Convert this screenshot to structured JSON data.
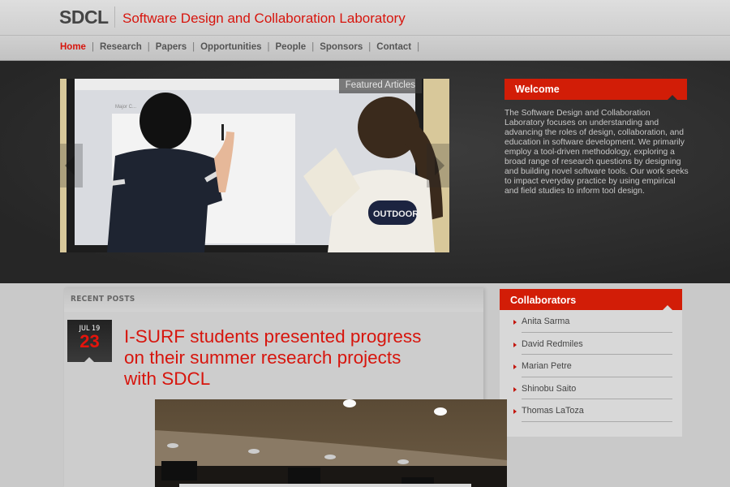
{
  "header": {
    "logo": "SDCL",
    "title": "Software Design and Collaboration Laboratory"
  },
  "nav": {
    "items": [
      {
        "label": "Home",
        "active": true
      },
      {
        "label": "Research"
      },
      {
        "label": "Papers"
      },
      {
        "label": "Opportunities"
      },
      {
        "label": "People"
      },
      {
        "label": "Sponsors"
      },
      {
        "label": "Contact"
      }
    ],
    "separator": "|"
  },
  "slider": {
    "label": "Featured Articles",
    "image_alt": "Students writing on a large interactive whiteboard"
  },
  "welcome": {
    "title": "Welcome",
    "text": "The Software Design and Collaboration Laboratory focuses on understanding and advancing the roles of design, collaboration, and education in software development. We primarily employ a tool-driven methodology, exploring a broad range of research questions by designing and building novel software tools. Our work seeks to impact everyday practice by using empirical and field studies to inform tool design."
  },
  "recent_posts": {
    "heading": "RECENT POSTS",
    "posts": [
      {
        "month_year": "JUL 19",
        "day": "23",
        "title": "I-SURF students presented progress on their summer research projects with SDCL",
        "image_alt": "Presentation room ceiling and screen"
      }
    ]
  },
  "collaborators": {
    "title": "Collaborators",
    "items": [
      "Anita Sarma",
      "David Redmiles",
      "Marian Petre",
      "Shinobu Saito",
      "Thomas LaToza"
    ]
  },
  "colors": {
    "accent": "#d7150d",
    "widget_header": "#d21d07",
    "dark_band": "#2e2e2e"
  }
}
